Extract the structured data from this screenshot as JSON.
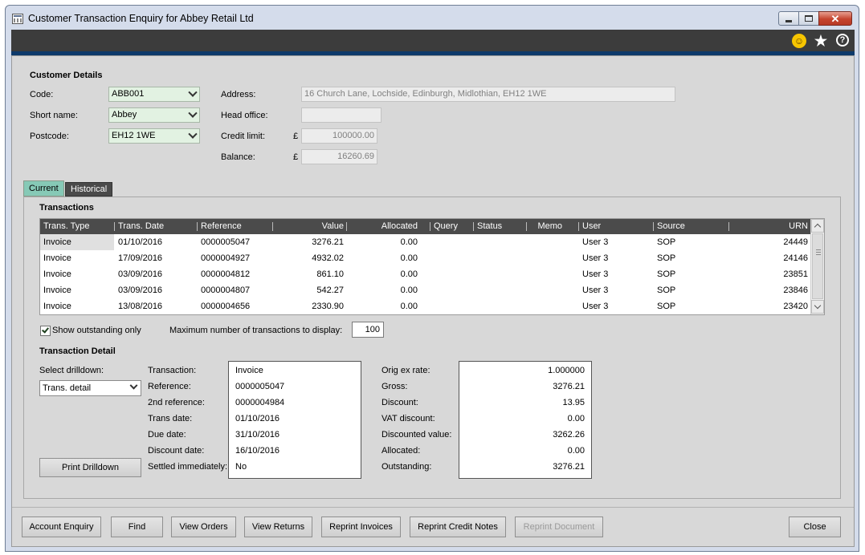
{
  "window": {
    "title": "Customer Transaction Enquiry for Abbey Retail Ltd"
  },
  "toolbar_icons": [
    "smiley-icon",
    "star-icon",
    "help-icon"
  ],
  "customer_details": {
    "heading": "Customer Details",
    "code_label": "Code:",
    "code_value": "ABB001",
    "short_name_label": "Short name:",
    "short_name_value": "Abbey",
    "postcode_label": "Postcode:",
    "postcode_value": "EH12 1WE",
    "address_label": "Address:",
    "address_value": "16 Church Lane, Lochside, Edinburgh, Midlothian, EH12 1WE",
    "head_office_label": "Head office:",
    "head_office_value": "",
    "credit_limit_label": "Credit limit:",
    "credit_limit_value": "100000.00",
    "balance_label": "Balance:",
    "balance_value": "16260.69",
    "currency_symbol": "£"
  },
  "tabs": [
    {
      "label": "Current",
      "active": true
    },
    {
      "label": "Historical",
      "active": false
    }
  ],
  "transactions": {
    "heading": "Transactions",
    "columns": [
      "Trans. Type",
      "Trans. Date",
      "Reference",
      "Value",
      "Allocated",
      "Query",
      "Status",
      "Memo",
      "User",
      "Source",
      "URN"
    ],
    "rows": [
      [
        "Invoice",
        "01/10/2016",
        "0000005047",
        "3276.21",
        "0.00",
        "",
        "",
        "",
        "User 3",
        "SOP",
        "24449"
      ],
      [
        "Invoice",
        "17/09/2016",
        "0000004927",
        "4932.02",
        "0.00",
        "",
        "",
        "",
        "User 3",
        "SOP",
        "24146"
      ],
      [
        "Invoice",
        "03/09/2016",
        "0000004812",
        "861.10",
        "0.00",
        "",
        "",
        "",
        "User 3",
        "SOP",
        "23851"
      ],
      [
        "Invoice",
        "03/09/2016",
        "0000004807",
        "542.27",
        "0.00",
        "",
        "",
        "",
        "User 3",
        "SOP",
        "23846"
      ],
      [
        "Invoice",
        "13/08/2016",
        "0000004656",
        "2330.90",
        "0.00",
        "",
        "",
        "",
        "User 3",
        "SOP",
        "23420"
      ]
    ],
    "show_outstanding_label": "Show outstanding only",
    "show_outstanding_checked": true,
    "max_label": "Maximum number of transactions to display:",
    "max_value": "100"
  },
  "detail": {
    "heading": "Transaction Detail",
    "drilldown_label": "Select drilldown:",
    "drilldown_value": "Trans. detail",
    "print_button": "Print Drilldown",
    "left_labels": [
      "Transaction:",
      "Reference:",
      "2nd reference:",
      "Trans date:",
      "Due date:",
      "Discount date:",
      "Settled immediately:"
    ],
    "left_values": [
      "Invoice",
      "0000005047",
      "0000004984",
      "01/10/2016",
      "31/10/2016",
      "16/10/2016",
      "No"
    ],
    "right_labels": [
      "Orig ex rate:",
      "Gross:",
      "Discount:",
      "VAT discount:",
      "Discounted value:",
      "Allocated:",
      "Outstanding:"
    ],
    "right_values": [
      "1.000000",
      "3276.21",
      "13.95",
      "0.00",
      "3262.26",
      "0.00",
      "3276.21"
    ]
  },
  "footer_buttons": {
    "account_enquiry": "Account Enquiry",
    "find": "Find",
    "view_orders": "View Orders",
    "view_returns": "View Returns",
    "reprint_invoices": "Reprint Invoices",
    "reprint_credit_notes": "Reprint Credit Notes",
    "reprint_document": "Reprint Document",
    "close": "Close"
  }
}
